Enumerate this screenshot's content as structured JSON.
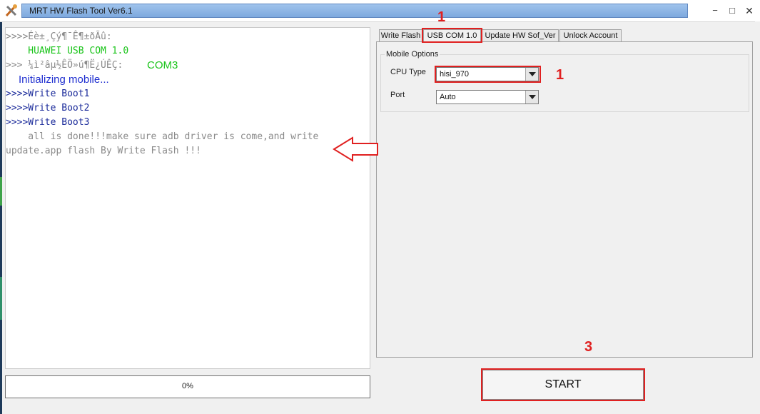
{
  "window": {
    "title": "MRT HW Flash Tool Ver6.1",
    "controls": {
      "minimize": "−",
      "maximize": "□",
      "close": "✕"
    }
  },
  "log": {
    "lines": [
      {
        "text": ">>>>Éè±¸Çý¶¯Ê¶±ðÃû:",
        "color": "gray"
      },
      {
        "text": "    HUAWEI USB COM 1.0",
        "color": "green"
      },
      {
        "text": ">>> ¼ì²âµ½ÊÖ»ú¶Ë¿ÚÊÇ:",
        "color": "gray"
      },
      {
        "text": "COM3",
        "color": "green"
      },
      {
        "text": "Initializing mobile...",
        "color": "blue"
      },
      {
        "text": ">>>>Write Boot1",
        "color": "navy"
      },
      {
        "text": ">>>>Write Boot2",
        "color": "navy"
      },
      {
        "text": ">>>>Write Boot3",
        "color": "navy"
      },
      {
        "text": "    all is done!!!make sure adb driver is come,and write",
        "color": "gray"
      },
      {
        "text": "update.app flash By Write Flash !!!",
        "color": "gray"
      }
    ]
  },
  "progress": {
    "label": "0%",
    "value": 0
  },
  "tabs": [
    {
      "label": "Write Flash",
      "active": false
    },
    {
      "label": "USB COM 1.0",
      "active": true
    },
    {
      "label": "Update HW Sof_Ver",
      "active": false
    },
    {
      "label": "Unlock Account",
      "active": false
    }
  ],
  "mobile_options": {
    "group_label": "Mobile Options",
    "cpu_type": {
      "label": "CPU Type",
      "value": "hisi_970"
    },
    "port": {
      "label": "Port",
      "value": "Auto"
    }
  },
  "start_button": {
    "label": "START"
  },
  "annotations": {
    "tab_number": "1",
    "cpu_number": "1",
    "start_number": "3",
    "color": "#e02020"
  }
}
